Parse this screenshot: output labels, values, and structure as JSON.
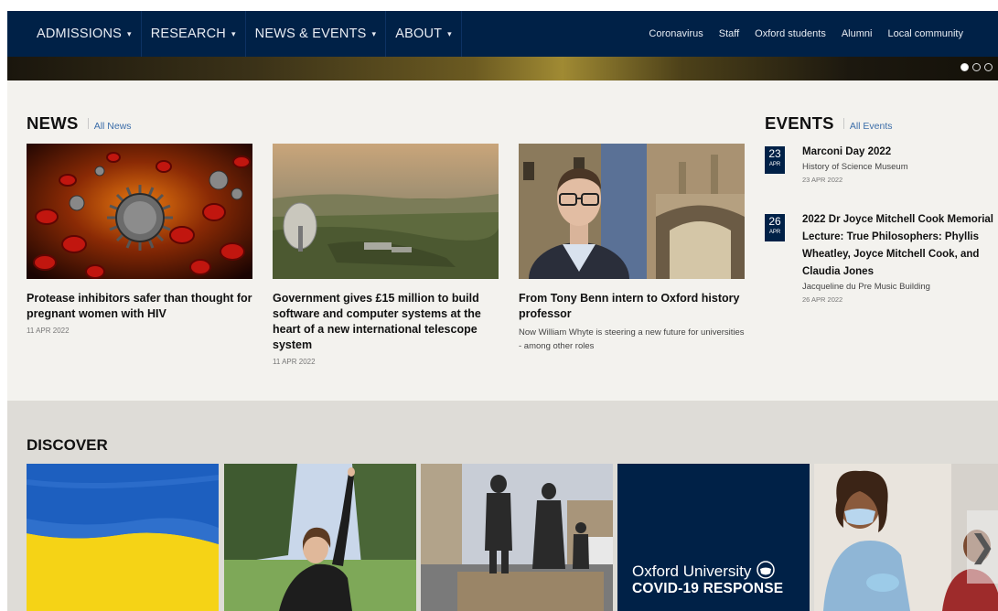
{
  "main_nav": [
    {
      "label": "ADMISSIONS"
    },
    {
      "label": "RESEARCH"
    },
    {
      "label": "NEWS & EVENTS"
    },
    {
      "label": "ABOUT"
    }
  ],
  "utility_nav": [
    "Coronavirus",
    "Staff",
    "Oxford students",
    "Alumni",
    "Local community"
  ],
  "news": {
    "heading": "NEWS",
    "all_link": "All News",
    "items": [
      {
        "title": "Protease inhibitors safer than thought for pregnant women with HIV",
        "date": "11 APR 2022",
        "image": "virus-illustration"
      },
      {
        "title": "Government gives £15 million to build software and computer systems at the heart of a new international telescope system",
        "date": "11 APR 2022",
        "image": "aerial-telescope-landscape"
      },
      {
        "title": "From Tony Benn intern to Oxford history professor",
        "description": "Now William Whyte is steering a new future for universities - among other roles",
        "image": "portrait-with-bridge"
      }
    ]
  },
  "events": {
    "heading": "EVENTS",
    "all_link": "All Events",
    "items": [
      {
        "day": "23",
        "month": "APR",
        "title": "Marconi Day 2022",
        "venue": "History of Science Museum",
        "date": "23 APR 2022"
      },
      {
        "day": "26",
        "month": "APR",
        "title": "2022 Dr Joyce Mitchell Cook Memorial Lecture: True Philosophers: Phyllis Wheatley, Joyce Mitchell Cook, and Claudia Jones",
        "venue": "Jacqueline du Pre Music Building",
        "date": "26 APR 2022"
      }
    ]
  },
  "discover": {
    "heading": "DISCOVER",
    "covid_line1": "Oxford University",
    "covid_line2": "COVID-19 RESPONSE",
    "tiles": [
      "ukraine-flag",
      "person-pointing-at-sky",
      "street-sculpture",
      "covid-response",
      "person-with-mask"
    ]
  },
  "colors": {
    "navy": "#002147",
    "link": "#3c6ea9",
    "news_bg": "#f3f2ee",
    "discover_bg": "#dedcd7"
  }
}
